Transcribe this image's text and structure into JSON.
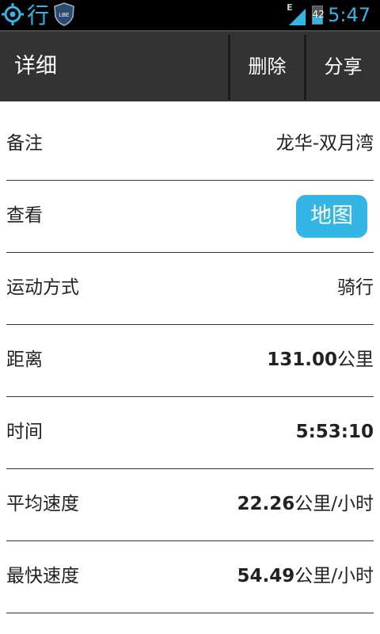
{
  "status_bar": {
    "app_glyph": "行",
    "badge_text": "LBE",
    "network": "E",
    "battery": "42",
    "battery_level": 0.42,
    "time": "5:47"
  },
  "action_bar": {
    "title": "详细",
    "delete_label": "删除",
    "share_label": "分享"
  },
  "rows": [
    {
      "label": "备注",
      "value": "龙华-双月湾"
    },
    {
      "label": "查看",
      "button": "地图"
    },
    {
      "label": "运动方式",
      "value": "骑行"
    },
    {
      "label": "距离",
      "value_num": "131.00",
      "value_unit": "公里"
    },
    {
      "label": "时间",
      "value_num": "5:53:10"
    },
    {
      "label": "平均速度",
      "value_num": "22.26",
      "value_unit": "公里/小时"
    },
    {
      "label": "最快速度",
      "value_num": "54.49",
      "value_unit": "公里/小时"
    }
  ],
  "colors": {
    "accent": "#33b5e5",
    "action_bar": "#333333",
    "status_bar": "#000000"
  }
}
